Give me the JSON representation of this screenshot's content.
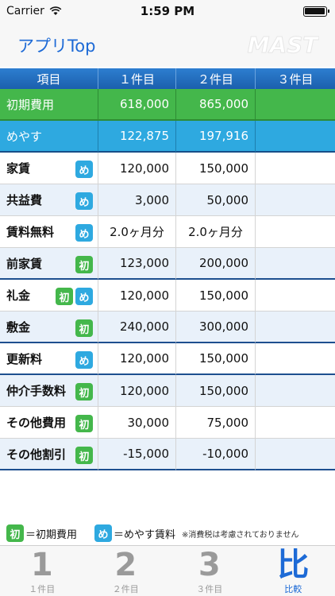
{
  "status": {
    "carrier": "Carrier",
    "time": "1:59 PM"
  },
  "nav": {
    "back_label": "アプリTop",
    "logo": "MAST"
  },
  "header": [
    "項目",
    "１件目",
    "２件目",
    "３件目"
  ],
  "rows": [
    {
      "label": "初期費用",
      "v1": "618,000",
      "v2": "865,000",
      "v3": ""
    },
    {
      "label": "めやす",
      "v1": "122,875",
      "v2": "197,916",
      "v3": ""
    },
    {
      "label": "家賃",
      "v1": "120,000",
      "v2": "150,000",
      "v3": ""
    },
    {
      "label": "共益費",
      "v1": "3,000",
      "v2": "50,000",
      "v3": ""
    },
    {
      "label": "賃料無料",
      "v1": "2.0ヶ月分",
      "v2": "2.0ヶ月分",
      "v3": ""
    },
    {
      "label": "前家賃",
      "v1": "123,000",
      "v2": "200,000",
      "v3": ""
    },
    {
      "label": "礼金",
      "v1": "120,000",
      "v2": "150,000",
      "v3": ""
    },
    {
      "label": "敷金",
      "v1": "240,000",
      "v2": "300,000",
      "v3": ""
    },
    {
      "label": "更新料",
      "v1": "120,000",
      "v2": "150,000",
      "v3": ""
    },
    {
      "label": "仲介手数料",
      "v1": "120,000",
      "v2": "150,000",
      "v3": ""
    },
    {
      "label": "その他費用",
      "v1": "30,000",
      "v2": "75,000",
      "v3": ""
    },
    {
      "label": "その他割引",
      "v1": "-15,000",
      "v2": "-10,000",
      "v3": ""
    }
  ],
  "badges": {
    "me": "め",
    "sho": "初"
  },
  "legend": {
    "sho_text": "＝初期費用",
    "me_text": "＝めやす賃料",
    "note": "※消費税は考慮されておりません"
  },
  "tabs": [
    {
      "glyph": "1",
      "label": "１件目"
    },
    {
      "glyph": "2",
      "label": "２件目"
    },
    {
      "glyph": "3",
      "label": "３件目"
    },
    {
      "glyph": "比",
      "label": "比較"
    }
  ],
  "colors": {
    "accent": "#1d6ad6",
    "green": "#44b74b",
    "blue": "#2ea9e0",
    "header": "#1b5fad"
  }
}
